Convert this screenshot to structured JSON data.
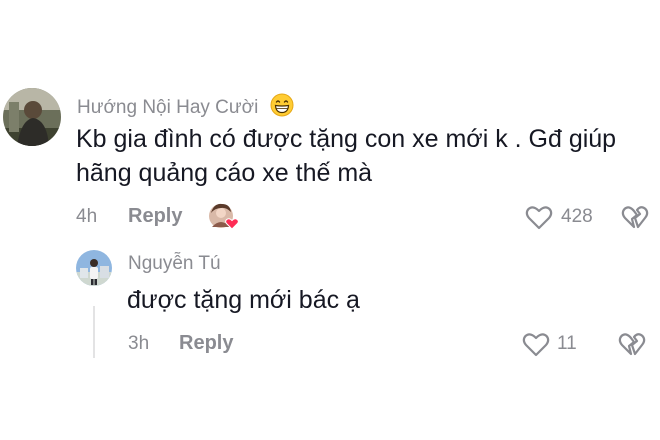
{
  "comment": {
    "username": "Hướng Nội Hay Cười",
    "text_line1": "Kb gia đình có được tặng con xe mới k . Gđ giúp",
    "text_line2": "hãng quảng cáo xe thế mà",
    "time": "4h",
    "reply_label": "Reply",
    "like_count": "428"
  },
  "reply": {
    "username": "Nguyễn Tú",
    "text": "được tặng mới bác ạ",
    "time": "3h",
    "reply_label": "Reply",
    "like_count": "11"
  },
  "colors": {
    "primary_text": "#161823",
    "secondary_text": "#8a8b91",
    "heart_accent": "#fe2c55"
  },
  "icons": {
    "emoji": "grinning-face-icon",
    "like": "heart-outline-icon",
    "dislike": "broken-heart-icon",
    "creator_liked": "liked-by-creator-avatar-icon"
  }
}
